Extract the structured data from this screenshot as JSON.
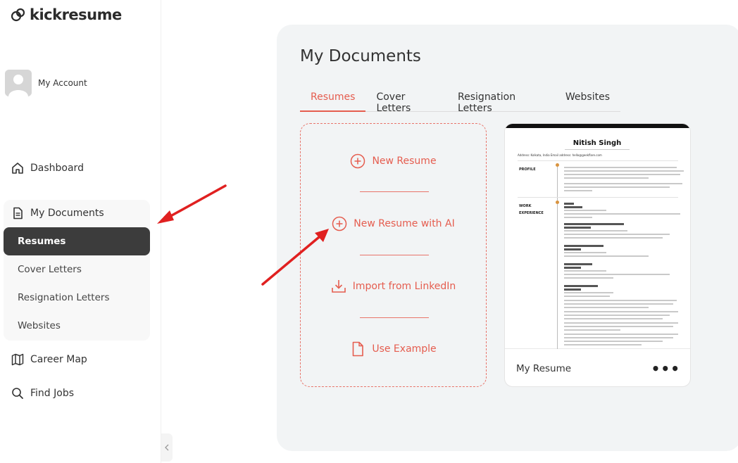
{
  "brand": {
    "name": "kickresume",
    "accent": "#e55d4f"
  },
  "sidebar": {
    "account_label": "My Account",
    "dashboard": "Dashboard",
    "my_documents": "My Documents",
    "sub_items": [
      "Resumes",
      "Cover Letters",
      "Resignation Letters",
      "Websites"
    ],
    "active_sub_item": "Resumes",
    "career_map": "Career Map",
    "find_jobs": "Find Jobs",
    "collapse_icon": "chevron-left-icon"
  },
  "main": {
    "title": "My Documents",
    "tabs": [
      "Resumes",
      "Cover Letters",
      "Resignation Letters",
      "Websites"
    ],
    "active_tab": "Resumes",
    "actions": {
      "new_resume": "New Resume",
      "new_resume_ai": "New Resume with AI",
      "import_linkedin": "Import from LinkedIn",
      "use_example": "Use Example"
    },
    "resume_card": {
      "title": "My Resume",
      "menu_icon": "more-horizontal-icon",
      "preview": {
        "name": "Nitish Singh",
        "address": "Address: Kolkata, India   Email address: hello@geekflare.com",
        "sections": [
          "PROFILE",
          "WORK",
          "EXPERIENCE"
        ]
      }
    }
  },
  "annotations": {
    "arrow_color": "#e02020"
  }
}
